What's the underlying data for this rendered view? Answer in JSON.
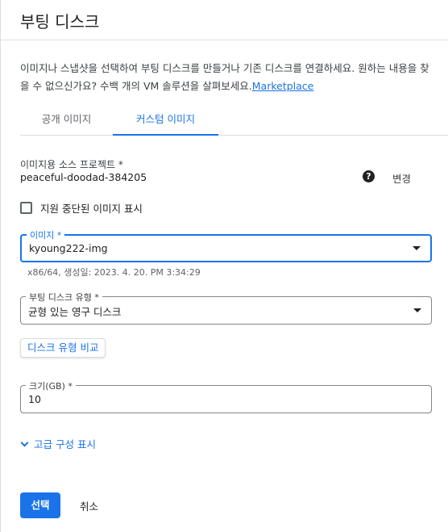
{
  "header": {
    "title": "부팅 디스크"
  },
  "description": {
    "text": "이미지나 스냅샷을 선택하여 부팅 디스크를 만들거나 기존 디스크를 연결하세요. 원하는 내용을 찾을 수 없으신가요? 수백 개의 VM 솔루션을 살펴보세요.",
    "link_label": "Marketplace"
  },
  "tabs": [
    {
      "label": "공개 이미지"
    },
    {
      "label": "커스텀 이미지"
    }
  ],
  "source_project": {
    "label": "이미지용 소스 프로젝트 *",
    "value": "peaceful-doodad-384205",
    "help_icon": "?",
    "change_label": "변경"
  },
  "deprecated_checkbox": {
    "label": "지원 중단된 이미지 표시",
    "checked": false
  },
  "image_select": {
    "label": "이미지 *",
    "value": "kyoung222-img",
    "hint": "x86/64, 생성일: 2023. 4. 20. PM 3:34:29"
  },
  "disk_type_select": {
    "label": "부팅 디스크 유형 *",
    "value": "균형 있는 영구 디스크"
  },
  "compare_button": {
    "label": "디스크 유형 비교"
  },
  "size_field": {
    "label": "크기(GB) *",
    "value": "10"
  },
  "advanced": {
    "label": "고급 구성 표시"
  },
  "actions": {
    "select_label": "선택",
    "cancel_label": "취소"
  },
  "colors": {
    "accent": "#1a73e8",
    "text": "#202124",
    "border": "#80868b"
  }
}
